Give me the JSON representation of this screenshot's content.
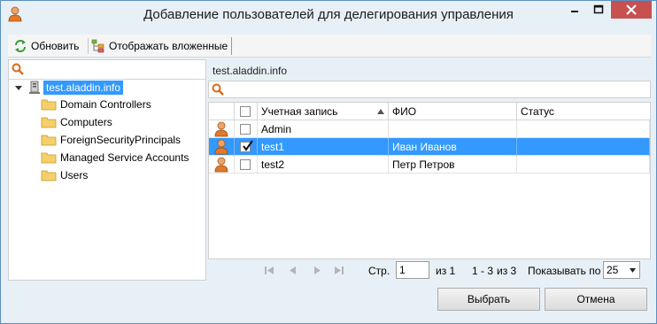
{
  "window": {
    "title": "Добавление пользователей для делегирования управления",
    "accent": "#3399ff"
  },
  "toolbar": {
    "refresh_label": "Обновить",
    "refresh_icon": "refresh-icon",
    "show_nested_label": "Отображать вложенные",
    "show_nested_icon": "nested-groups-icon"
  },
  "tree": {
    "root_label": "test.aladdin.info",
    "nodes": [
      {
        "label": "Domain Controllers"
      },
      {
        "label": "Computers"
      },
      {
        "label": "ForeignSecurityPrincipals"
      },
      {
        "label": "Managed Service Accounts"
      },
      {
        "label": "Users"
      }
    ]
  },
  "right": {
    "header": "test.aladdin.info",
    "search_placeholder": ""
  },
  "grid": {
    "columns": {
      "account": "Учетная запись",
      "fio": "ФИО",
      "status": "Статус"
    },
    "sort_column": "account",
    "sort_direction": "ascending",
    "rows": [
      {
        "account": "Admin",
        "fio": "",
        "status": "",
        "checked": false,
        "selected": false
      },
      {
        "account": "test1",
        "fio": "Иван Иванов",
        "status": "",
        "checked": true,
        "selected": true
      },
      {
        "account": "test2",
        "fio": "Петр Петров",
        "status": "",
        "checked": false,
        "selected": false
      }
    ]
  },
  "pager": {
    "page_label": "Стр.",
    "page_value": "1",
    "of_pages": "из 1",
    "range": "1 - 3",
    "of_total": "из 3",
    "page_size_label": "Показывать по",
    "page_size": "25"
  },
  "buttons": {
    "select": "Выбрать",
    "cancel": "Отмена"
  }
}
